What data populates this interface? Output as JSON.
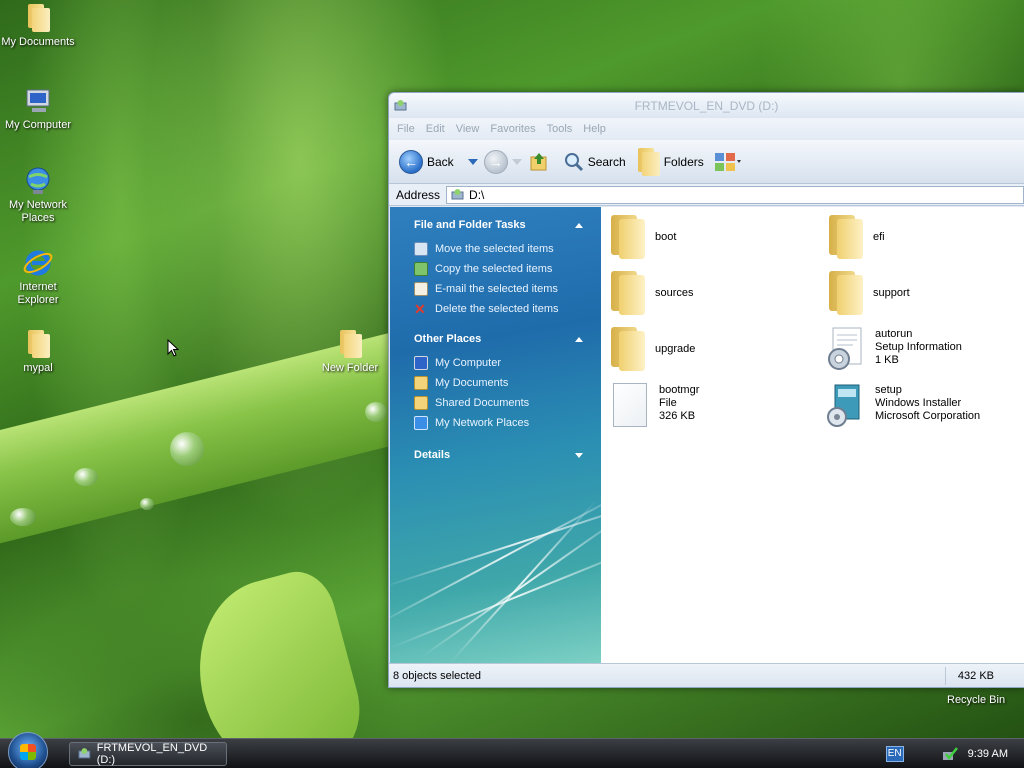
{
  "desktop": {
    "icons": [
      {
        "label": "My Documents"
      },
      {
        "label": "My Computer"
      },
      {
        "label": "My Network Places"
      },
      {
        "label": "Internet Explorer"
      },
      {
        "label": "mypal"
      },
      {
        "label": "New Folder"
      }
    ],
    "recycle_bin": "Recycle Bin"
  },
  "window": {
    "title": "FRTMEVOL_EN_DVD (D:)",
    "menu": [
      "File",
      "Edit",
      "View",
      "Favorites",
      "Tools",
      "Help"
    ],
    "toolbar": {
      "back": "Back",
      "search": "Search",
      "folders": "Folders"
    },
    "address": {
      "label": "Address",
      "value": "D:\\"
    },
    "tasks": {
      "file_folder": {
        "title": "File and Folder Tasks",
        "items": [
          "Move the selected items",
          "Copy the selected items",
          "E-mail the selected items",
          "Delete the selected items"
        ]
      },
      "other_places": {
        "title": "Other Places",
        "items": [
          "My Computer",
          "My Documents",
          "Shared Documents",
          "My Network Places"
        ]
      },
      "details": {
        "title": "Details"
      }
    },
    "files": [
      {
        "name": "boot"
      },
      {
        "name": "efi"
      },
      {
        "name": "sources"
      },
      {
        "name": "support"
      },
      {
        "name": "upgrade"
      },
      {
        "name": "autorun",
        "type": "Setup Information",
        "size": "1 KB"
      },
      {
        "name": "bootmgr",
        "type": "File",
        "size": "326 KB"
      },
      {
        "name": "setup",
        "type": "Windows Installer",
        "company": "Microsoft Corporation"
      }
    ],
    "status": {
      "selected": "8 objects selected",
      "size": "432 KB"
    }
  },
  "taskbar": {
    "task_button": "FRTMEVOL_EN_DVD (D:)",
    "language": "EN",
    "clock": "9:39 AM"
  }
}
